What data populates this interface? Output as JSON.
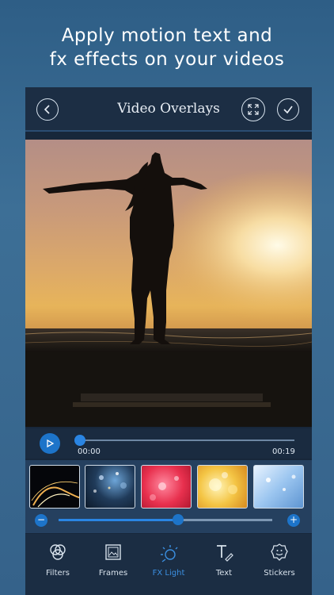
{
  "promo": {
    "line1": "Apply motion text and",
    "line2": "fx effects on your videos"
  },
  "header": {
    "title": "Video Overlays",
    "back_icon": "back-icon",
    "fullscreen_icon": "fullscreen-icon",
    "confirm_icon": "check-icon"
  },
  "player": {
    "current_time": "00:00",
    "duration": "00:19",
    "progress": 0
  },
  "effects": {
    "thumbnails": [
      "light-streak",
      "bokeh-blue",
      "red-hearts",
      "golden-bokeh",
      "blue-sparkle"
    ],
    "intensity": 0.56
  },
  "tabs": [
    {
      "label": "Filters",
      "icon": "filters-icon"
    },
    {
      "label": "Frames",
      "icon": "frames-icon"
    },
    {
      "label": "FX Light",
      "icon": "fx-light-icon",
      "active": true
    },
    {
      "label": "Text",
      "icon": "text-icon"
    },
    {
      "label": "Stickers",
      "icon": "stickers-icon"
    }
  ],
  "colors": {
    "accent": "#2a85e3",
    "active_tab": "#3b8fe0",
    "background": "#35628a"
  }
}
